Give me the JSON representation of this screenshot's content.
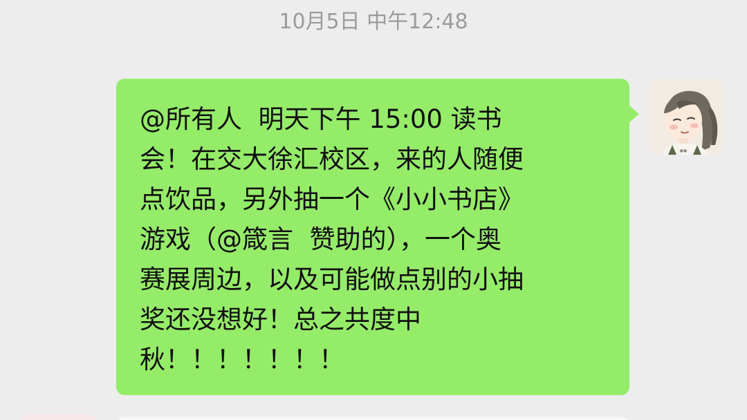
{
  "chat": {
    "timestamp": "10月5日 中午12:48",
    "message": {
      "lines": [
        "@所有人  明天下午 15:00 读书",
        "会！在交大徐汇校区，来的人随便",
        "点饮品，另外抽一个《小小书店》",
        "游戏（@箴言  赞助的），一个奥",
        "赛展周边，以及可能做点别的小抽",
        "奖还没想好！总之共度中",
        "秋！！！！！！！"
      ],
      "bubble_color": "#95ec69",
      "sender": "self"
    },
    "avatar": {
      "icon": "girl-illustration-avatar-icon"
    }
  },
  "colors": {
    "background": "#ededed",
    "timestamp": "#9b9b9b",
    "text": "#111111"
  }
}
